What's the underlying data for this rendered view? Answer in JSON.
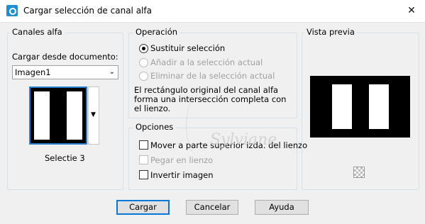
{
  "window": {
    "title": "Cargar selección de canal alfa",
    "close_glyph": "✕"
  },
  "channels": {
    "title": "Canales alfa",
    "load_label": "Cargar desde documento:",
    "document_value": "Imagen1",
    "selection_name": "Selectie 3"
  },
  "operation": {
    "title": "Operación",
    "options": [
      {
        "label": "Sustituir selección",
        "selected": true,
        "enabled": true
      },
      {
        "label": "Añadir a la selección actual",
        "selected": false,
        "enabled": false
      },
      {
        "label": "Eliminar de la selección actual",
        "selected": false,
        "enabled": false
      }
    ],
    "description_line1": "El rectángulo original del canal alfa",
    "description_line2": "forma una intersección completa con",
    "description_line3": "el lienzo."
  },
  "options": {
    "title": "Opciones",
    "checks": [
      {
        "label": "Mover a parte superior izda. del lienzo",
        "checked": false,
        "enabled": true
      },
      {
        "label": "Pegar en lienzo",
        "checked": false,
        "enabled": false
      },
      {
        "label": "Invertir imagen",
        "checked": false,
        "enabled": true
      }
    ]
  },
  "preview": {
    "title": "Vista previa"
  },
  "buttons": {
    "load": "Cargar",
    "cancel": "Cancelar",
    "help": "Ayuda"
  },
  "watermark_text": "Sylviane",
  "colors": {
    "accent": "#0078d7",
    "disabled_text": "#a0a0a0"
  }
}
